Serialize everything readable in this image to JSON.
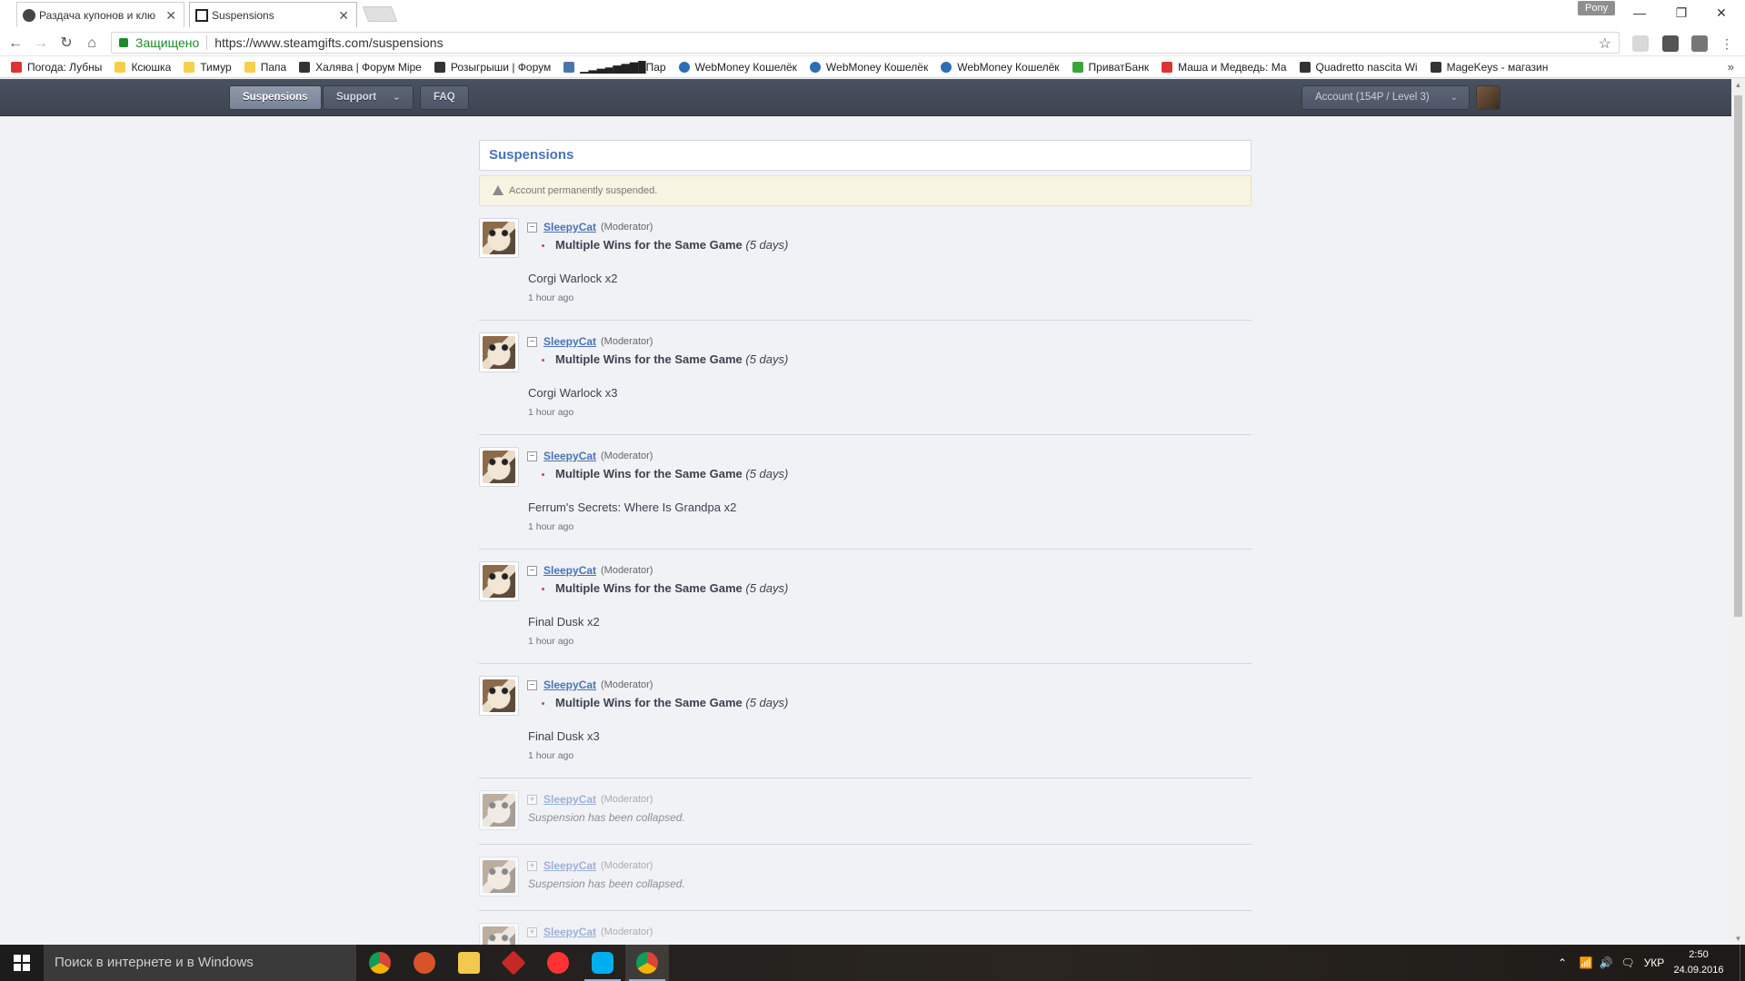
{
  "browser": {
    "tabs": [
      {
        "title": "Раздача купонов и клю",
        "active": false
      },
      {
        "title": "Suspensions",
        "active": true
      }
    ],
    "profile": "Pony",
    "security_label": "Защищено",
    "url": "https://www.steamgifts.com/suspensions",
    "bookmarks": [
      {
        "label": "Погода: Лубны",
        "icon": "thermometer-icon"
      },
      {
        "label": "Ксюшка",
        "icon": "folder-icon"
      },
      {
        "label": "Тимур",
        "icon": "folder-icon"
      },
      {
        "label": "Папа",
        "icon": "folder-icon"
      },
      {
        "label": "Халява | Форум Міре",
        "icon": "forum-icon"
      },
      {
        "label": "Розыгрыши | Форум",
        "icon": "forum-icon"
      },
      {
        "label": "▁▂▃▄▅▆▇█Пар",
        "icon": "vk-icon"
      },
      {
        "label": "WebMoney Кошелёк",
        "icon": "globe-icon"
      },
      {
        "label": "WebMoney Кошелёк",
        "icon": "globe-icon"
      },
      {
        "label": "WebMoney Кошелёк",
        "icon": "globe-icon"
      },
      {
        "label": "ПриватБанк",
        "icon": "privatbank-icon"
      },
      {
        "label": "Маша и Медведь: Ма",
        "icon": "pin-icon"
      },
      {
        "label": "Quadretto nascita Wi",
        "icon": "shop-icon"
      },
      {
        "label": "MageKeys - магазин",
        "icon": "magekeys-icon"
      }
    ],
    "bookmarks_more": "»"
  },
  "site": {
    "nav": {
      "suspensions": "Suspensions",
      "support": "Support",
      "faq": "FAQ",
      "account": "Account (154P / Level 3)"
    },
    "heading": "Suspensions",
    "notice": "Account permanently suspended."
  },
  "entries": [
    {
      "user": "SleepyCat",
      "role": "(Moderator)",
      "reason": "Multiple Wins for the Same Game",
      "duration": "(5 days)",
      "game": "Corgi Warlock x2",
      "time": "1 hour ago",
      "toggle": "−"
    },
    {
      "user": "SleepyCat",
      "role": "(Moderator)",
      "reason": "Multiple Wins for the Same Game",
      "duration": "(5 days)",
      "game": "Corgi Warlock x3",
      "time": "1 hour ago",
      "toggle": "−"
    },
    {
      "user": "SleepyCat",
      "role": "(Moderator)",
      "reason": "Multiple Wins for the Same Game",
      "duration": "(5 days)",
      "game": "Ferrum's Secrets: Where Is Grandpa x2",
      "time": "1 hour ago",
      "toggle": "−"
    },
    {
      "user": "SleepyCat",
      "role": "(Moderator)",
      "reason": "Multiple Wins for the Same Game",
      "duration": "(5 days)",
      "game": "Final Dusk x2",
      "time": "1 hour ago",
      "toggle": "−"
    },
    {
      "user": "SleepyCat",
      "role": "(Moderator)",
      "reason": "Multiple Wins for the Same Game",
      "duration": "(5 days)",
      "game": "Final Dusk x3",
      "time": "1 hour ago",
      "toggle": "−"
    }
  ],
  "collapsed_entries": [
    {
      "user": "SleepyCat",
      "role": "(Moderator)",
      "message": "Suspension has been collapsed.",
      "toggle": "+"
    },
    {
      "user": "SleepyCat",
      "role": "(Moderator)",
      "message": "Suspension has been collapsed.",
      "toggle": "+"
    },
    {
      "user": "SleepyCat",
      "role": "(Moderator)",
      "message": "",
      "toggle": "+"
    }
  ],
  "taskbar": {
    "search_placeholder": "Поиск в интернете и в Windows",
    "language": "УКР",
    "time": "2:50",
    "date": "24.09.2016"
  },
  "colors": {
    "link": "#4b72b8",
    "header": "#3d4451",
    "notice_bg": "#f7f5e1",
    "page_bg": "#f0f2f5"
  }
}
